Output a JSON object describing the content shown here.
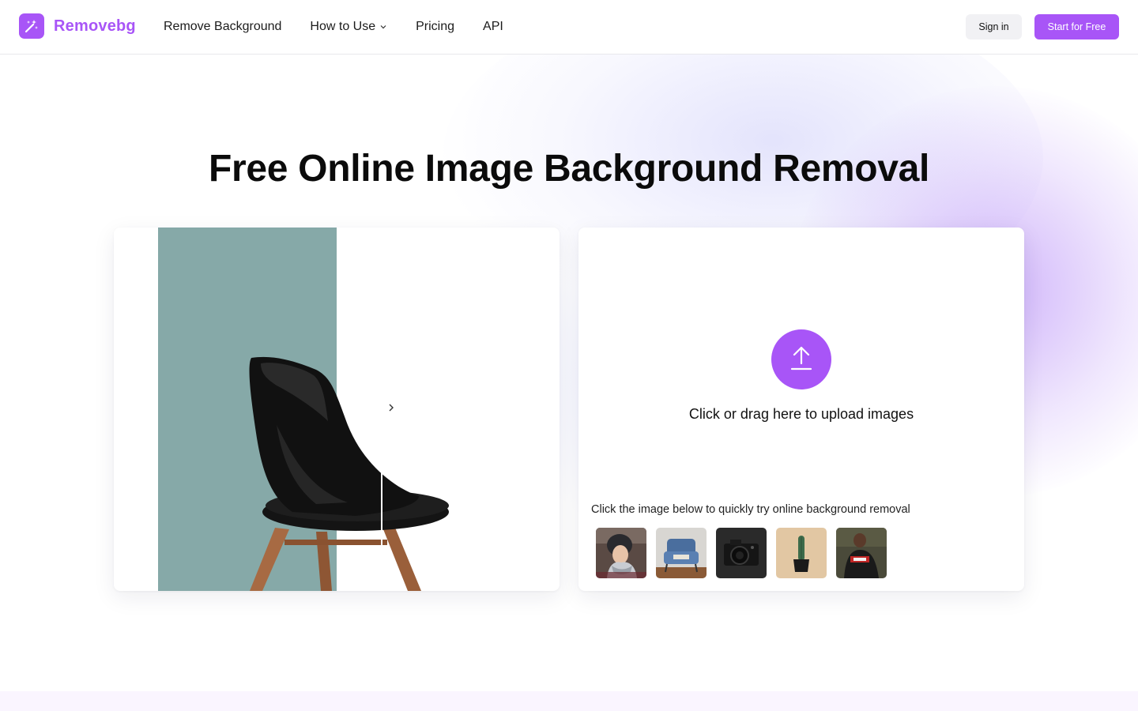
{
  "brand": {
    "name": "Removebg",
    "accent": "#a855f7",
    "logo_icon": "magic-wand-icon"
  },
  "nav": {
    "items": [
      {
        "label": "Remove Background"
      },
      {
        "label": "How to Use",
        "has_dropdown": true
      },
      {
        "label": "Pricing"
      },
      {
        "label": "API"
      }
    ]
  },
  "header": {
    "signin_label": "Sign in",
    "start_label": "Start for Free"
  },
  "hero": {
    "title": "Free Online Image Background Removal"
  },
  "demo": {
    "image": "black chair comparison",
    "before_bg_color": "#86a9a8",
    "slider_position": 0.5
  },
  "upload": {
    "icon": "upload-arrow-icon",
    "text": "Click or drag here to upload images",
    "try_label": "Click the image below to quickly try online background removal",
    "samples": [
      "woman in beanie",
      "blue armchair",
      "camera",
      "cactus in pot",
      "man in jacket"
    ]
  }
}
